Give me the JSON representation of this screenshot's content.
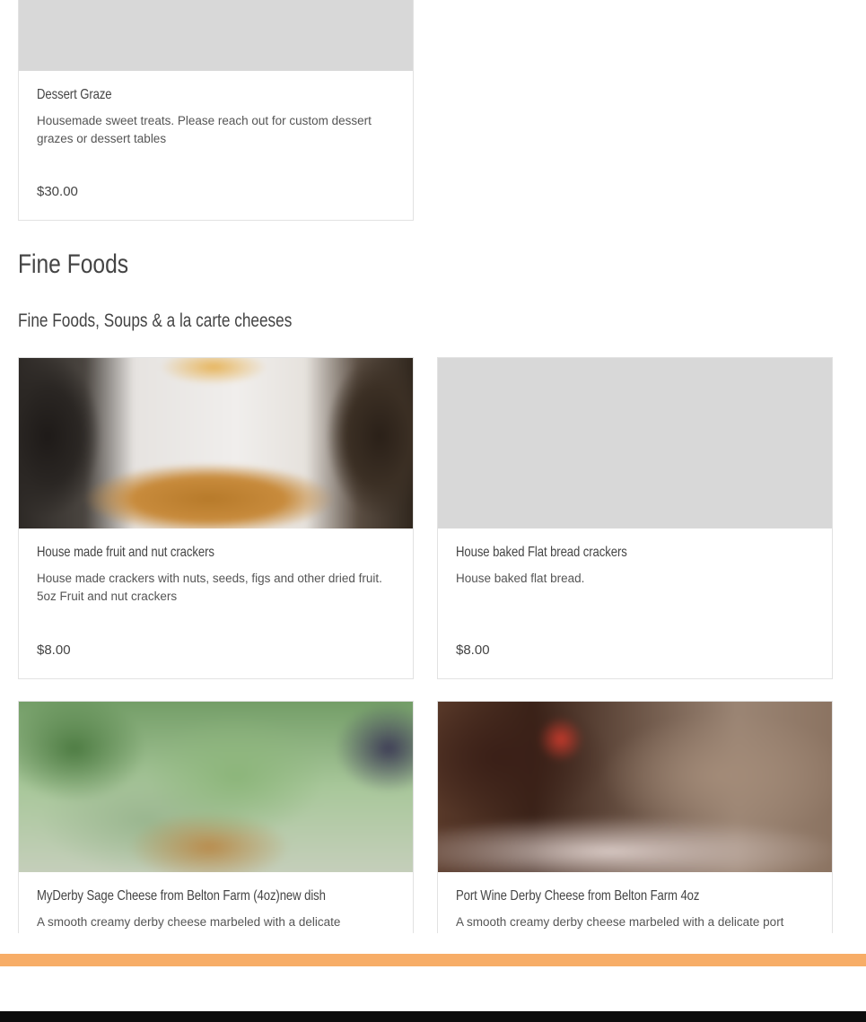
{
  "dessert": {
    "title": "Dessert Graze",
    "description": "Housemade sweet treats. Please reach out for custom dessert grazes or dessert tables",
    "price": "$30.00"
  },
  "section": {
    "title": "Fine Foods",
    "subtitle": "Fine Foods, Soups & a la carte cheeses"
  },
  "products": [
    {
      "title": "House made fruit and nut crackers",
      "description": "House made crackers with nuts, seeds, figs and other dried fruit. 5oz Fruit and nut crackers",
      "price": "$8.00"
    },
    {
      "title": "House baked Flat bread crackers",
      "description": "House baked flat bread.",
      "price": "$8.00"
    },
    {
      "title": "MyDerby Sage Cheese from Belton Farm (4oz)new dish",
      "description": "A smooth creamy derby cheese marbeled with a delicate"
    },
    {
      "title": "Port Wine Derby Cheese from Belton Farm 4oz",
      "description": "A smooth creamy derby cheese marbeled with a delicate port"
    }
  ],
  "colors": {
    "accent_bar": "#f7ad67",
    "footer": "#0d0d0d",
    "placeholder": "#d8d8d8"
  }
}
